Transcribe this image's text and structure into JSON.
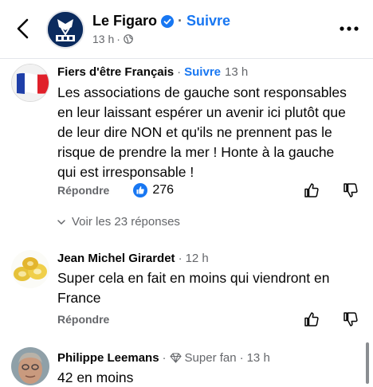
{
  "header": {
    "page_name": "Le Figaro",
    "separator": "·",
    "follow_label": "Suivre",
    "timestamp": "13 h",
    "meta_separator": "·",
    "icons": {
      "back": "chevron-left-icon",
      "verified": "verified-badge-icon",
      "privacy": "globe-icon",
      "more": "more-options-icon"
    },
    "colors": {
      "accent": "#1877f2",
      "logo_bg": "#0b2b5e"
    }
  },
  "comments": [
    {
      "author": "Fiers d'être Français",
      "separator": "·",
      "follow_label": "Suivre",
      "time": "13 h",
      "text_lines": [
        "Les associations de gauche sont responsables",
        "en leur laissant espérer un avenir ici plutôt que",
        "de leur dire NON et qu'ils ne prennent pas le",
        "risque de prendre la mer ! Honte à la gauche",
        "qui est irresponsable !"
      ],
      "reply_label": "Répondre",
      "reaction_count": "276",
      "view_replies_label": "Voir les 23 réponses"
    },
    {
      "author": "Jean Michel Girardet",
      "separator": "·",
      "time": "12 h",
      "text_lines": [
        "Super cela en fait en moins qui viendront en",
        "France"
      ],
      "reply_label": "Répondre"
    },
    {
      "author": "Philippe Leemans",
      "separator": "·",
      "badge_label": "Super fan",
      "separator2": "·",
      "time": "13 h",
      "text_lines": [
        "42 en moins"
      ]
    }
  ]
}
